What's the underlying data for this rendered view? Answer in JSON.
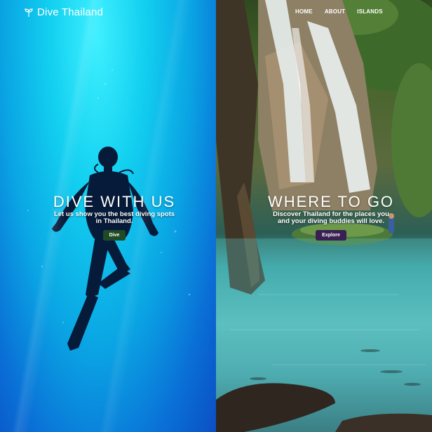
{
  "brand": {
    "name": "Dive Thailand",
    "icon": "leaf-icon"
  },
  "nav": {
    "items": [
      "HOME",
      "ABOUT",
      "ISLANDS"
    ]
  },
  "panels": [
    {
      "title": "DIVE WITH US",
      "subtitle_line1": "Let us show you the best diving spots",
      "subtitle_line2": "in Thailand.",
      "button": "Dive",
      "button_color": "#1f4a26"
    },
    {
      "title": "WHERE TO GO",
      "subtitle_line1": "Discover Thailand for the places you",
      "subtitle_line2": "and your diving buddies will love.",
      "button": "Explore",
      "button_color": "#3a1f52"
    }
  ]
}
